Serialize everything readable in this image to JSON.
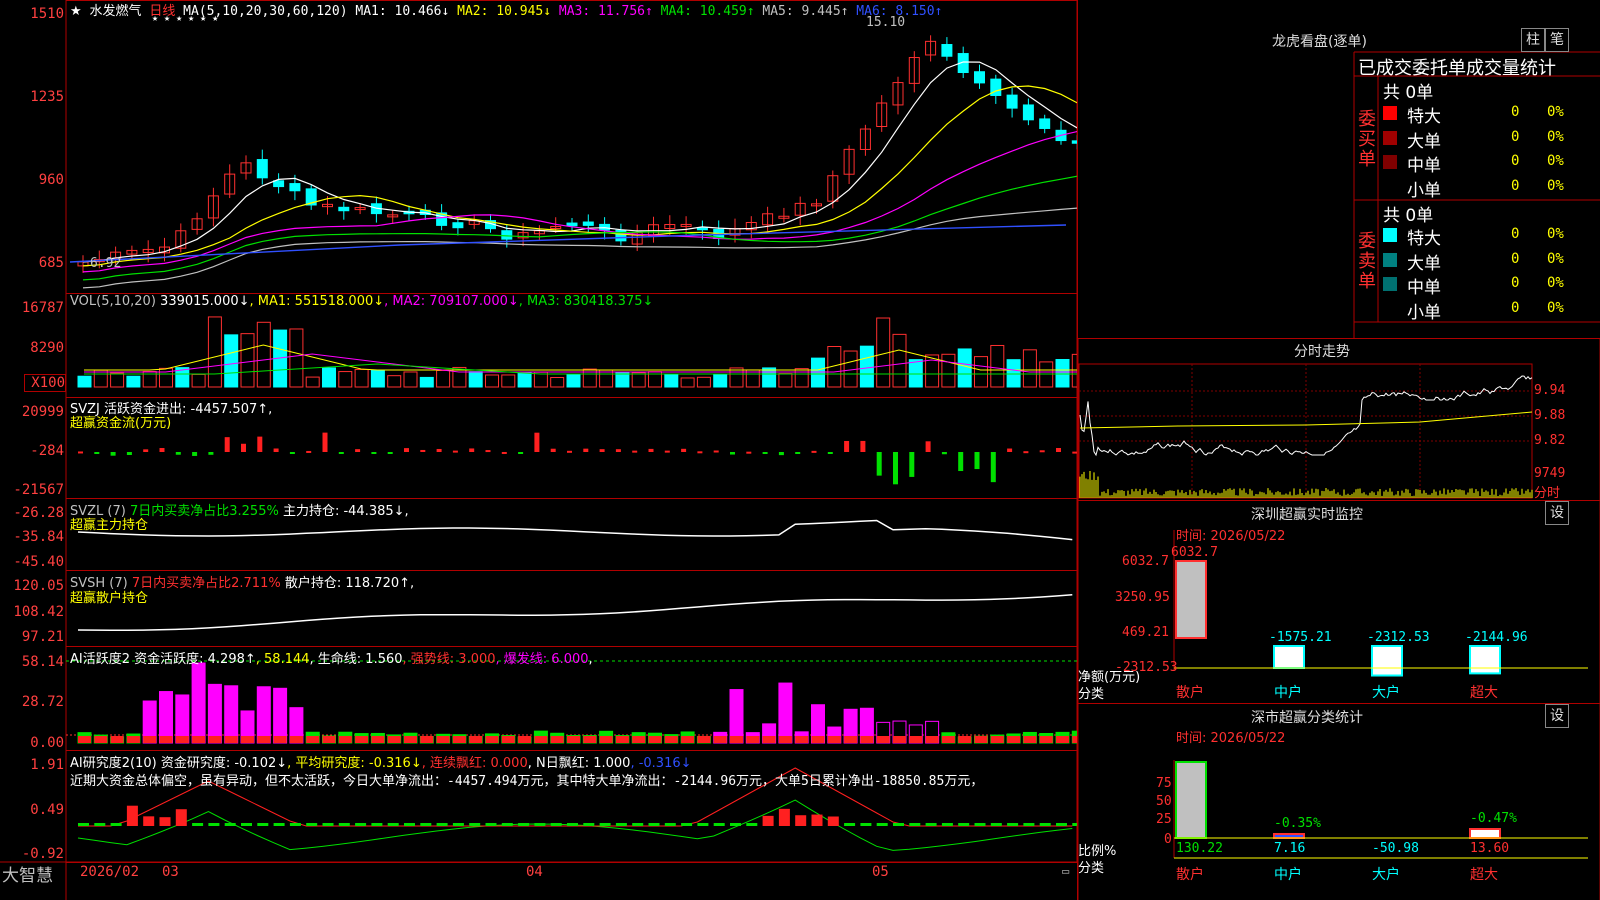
{
  "stock": {
    "name": "水发燃气",
    "period": "日线",
    "ma_label": "MA(5,10,20,30,60,120)",
    "ma": [
      {
        "label": "MA1: 10.466↓",
        "color": "#ffffff"
      },
      {
        "label": "MA2: 10.945↓",
        "color": "#ffff00"
      },
      {
        "label": "MA3: 11.756↑",
        "color": "#ff00ff"
      },
      {
        "label": "MA4: 10.459↑",
        "color": "#00e000"
      },
      {
        "label": "MA5: 9.445↑",
        "color": "#c0c0c0"
      },
      {
        "label": "MA6: 8.150↑",
        "color": "#3050ff"
      }
    ],
    "high_mark": "15.10",
    "low_mark": "6.92",
    "stars": "★ ★ ★ ★ ★ ★"
  },
  "axes": {
    "price": [
      "1510",
      "1235",
      "960",
      "685"
    ],
    "vol": [
      "16787",
      "8290",
      "X100"
    ],
    "svzj": [
      "20999",
      "-284",
      "-21567"
    ],
    "svzl": [
      "-26.28",
      "-35.84",
      "-45.40"
    ],
    "svsh": [
      "120.05",
      "108.42",
      "97.21"
    ],
    "ai": [
      "58.14",
      "28.72",
      "0.00"
    ],
    "ai2": [
      "1.91",
      "0.49",
      "-0.92"
    ]
  },
  "panels": {
    "vol_header": [
      {
        "t": "VOL(5,10,20) ",
        "c": "#c0c0c0"
      },
      {
        "t": "339015.000↓",
        "c": "#ffffff"
      },
      {
        "t": ", MA1: 551518.000↓",
        "c": "#ffff00"
      },
      {
        "t": ", MA2: 709107.000↓",
        "c": "#ff00ff"
      },
      {
        "t": ", MA3: 830418.375↓",
        "c": "#00e000"
      }
    ],
    "svzj_header": [
      {
        "t": "SVZJ  活跃资金进出: -4457.507↑,",
        "c": "#ffffff"
      }
    ],
    "svzj_sub": "超赢资金流(万元)",
    "svzl_header": [
      {
        "t": "SVZL (7) ",
        "c": "#c0c0c0"
      },
      {
        "t": "7日内买卖净占比3.255%",
        "c": "#00e000"
      },
      {
        "t": " 主力持仓: -44.385↓,",
        "c": "#ffffff"
      }
    ],
    "svzl_sub": "超赢主力持仓",
    "svsh_header": [
      {
        "t": "SVSH (7) ",
        "c": "#c0c0c0"
      },
      {
        "t": "7日内买卖净占比2.711%",
        "c": "#ff3030"
      },
      {
        "t": " 散户持仓: 118.720↑,",
        "c": "#ffffff"
      }
    ],
    "svsh_sub": "超赢散户持仓",
    "ai_header": [
      {
        "t": "AI活跃度2 资金活跃度: 4.298↑",
        "c": "#ffffff"
      },
      {
        "t": ", 58.144",
        "c": "#ffff00"
      },
      {
        "t": ", 生命线: 1.560",
        "c": "#ffffff"
      },
      {
        "t": ", 强势线: 3.000",
        "c": "#ff3030"
      },
      {
        "t": ", 爆发线: 6.000",
        "c": "#ff00ff"
      },
      {
        "t": ",",
        "c": "#ffffff"
      }
    ],
    "ai2_header": [
      {
        "t": "AI研究度2(10) 资金研究度: -0.102↓",
        "c": "#ffffff"
      },
      {
        "t": ", 平均研究度: -0.316↓",
        "c": "#ffff00"
      },
      {
        "t": ", 连续飘红: 0.000",
        "c": "#ff3030"
      },
      {
        "t": ", N日飘红: 1.000",
        "c": "#ffffff"
      },
      {
        "t": ", -0.316↓",
        "c": "#3050ff"
      }
    ],
    "ai2_text": "近期大资金总体偏空，虽有异动，但不太活跃，今日大单净流出：-4457.494万元，其中特大单净流出：-2144.96万元，大单5日累计净出-18850.85万元，"
  },
  "xaxis": {
    "year": "2026/02",
    "labels": [
      "03",
      "04",
      "05"
    ]
  },
  "brand": "大智慧",
  "right": {
    "lhb_title": "龙虎看盘(逐单)",
    "btn_zhu": "柱",
    "btn_bi": "笔",
    "order_title": "已成交委托单成交量统计",
    "buy_label": "委买单",
    "sell_label": "委卖单",
    "buy_total": "共 0单",
    "sell_total": "共 0单",
    "buy_rows": [
      {
        "name": "特大",
        "n": "0",
        "p": "0%",
        "color": "#ff0000"
      },
      {
        "name": "大单",
        "n": "0",
        "p": "0%",
        "color": "#a00000"
      },
      {
        "name": "中单",
        "n": "0",
        "p": "0%",
        "color": "#800000"
      },
      {
        "name": "小单",
        "n": "0",
        "p": "0%",
        "color": ""
      }
    ],
    "sell_rows": [
      {
        "name": "特大",
        "n": "0",
        "p": "0%",
        "color": "#00ffff"
      },
      {
        "name": "大单",
        "n": "0",
        "p": "0%",
        "color": "#008080"
      },
      {
        "name": "中单",
        "n": "0",
        "p": "0%",
        "color": "#007070"
      },
      {
        "name": "小单",
        "n": "0",
        "p": "0%",
        "color": ""
      }
    ],
    "fenshi_title": "分时走势",
    "fenshi_prices": [
      "9.94",
      "9.88",
      "9.82"
    ],
    "fenshi_vol": "9749",
    "fenshi_label": "分时",
    "sz_title": "深圳超赢实时监控",
    "sz_set": "设",
    "sz_time": "时间: 2026/05/22",
    "sz_axis": [
      "6032.7",
      "3250.95",
      "469.21",
      "-2312.53"
    ],
    "sz_values": [
      {
        "cat": "散户",
        "val": 6032.7,
        "label": "6032.7"
      },
      {
        "cat": "中户",
        "val": -1575.21,
        "label": "-1575.21"
      },
      {
        "cat": "大户",
        "val": -2312.53,
        "label": "-2312.53"
      },
      {
        "cat": "超大",
        "val": -2144.96,
        "label": "-2144.96"
      }
    ],
    "sz_ylabel": "净额(万元)",
    "sz_xlabel": "分类",
    "cls_title": "深市超赢分类统计",
    "cls_set": "设",
    "cls_time": "时间: 2026/05/22",
    "cls_axis": [
      "75",
      "50",
      "25",
      "0"
    ],
    "cls_values": [
      {
        "cat": "散户",
        "pct": "",
        "val": "130.22"
      },
      {
        "cat": "中户",
        "pct": "-0.35%",
        "val": "7.16"
      },
      {
        "cat": "大户",
        "pct": "",
        "val": "-50.98"
      },
      {
        "cat": "超大",
        "pct": "-0.47%",
        "val": "13.60"
      }
    ],
    "cls_ylabel": "比例%",
    "cls_xlabel": "分类"
  },
  "colors": {
    "up": "#ff3030",
    "down": "#00ffff",
    "frame": "#b00000",
    "green": "#00e000",
    "magenta": "#ff00ff"
  }
}
